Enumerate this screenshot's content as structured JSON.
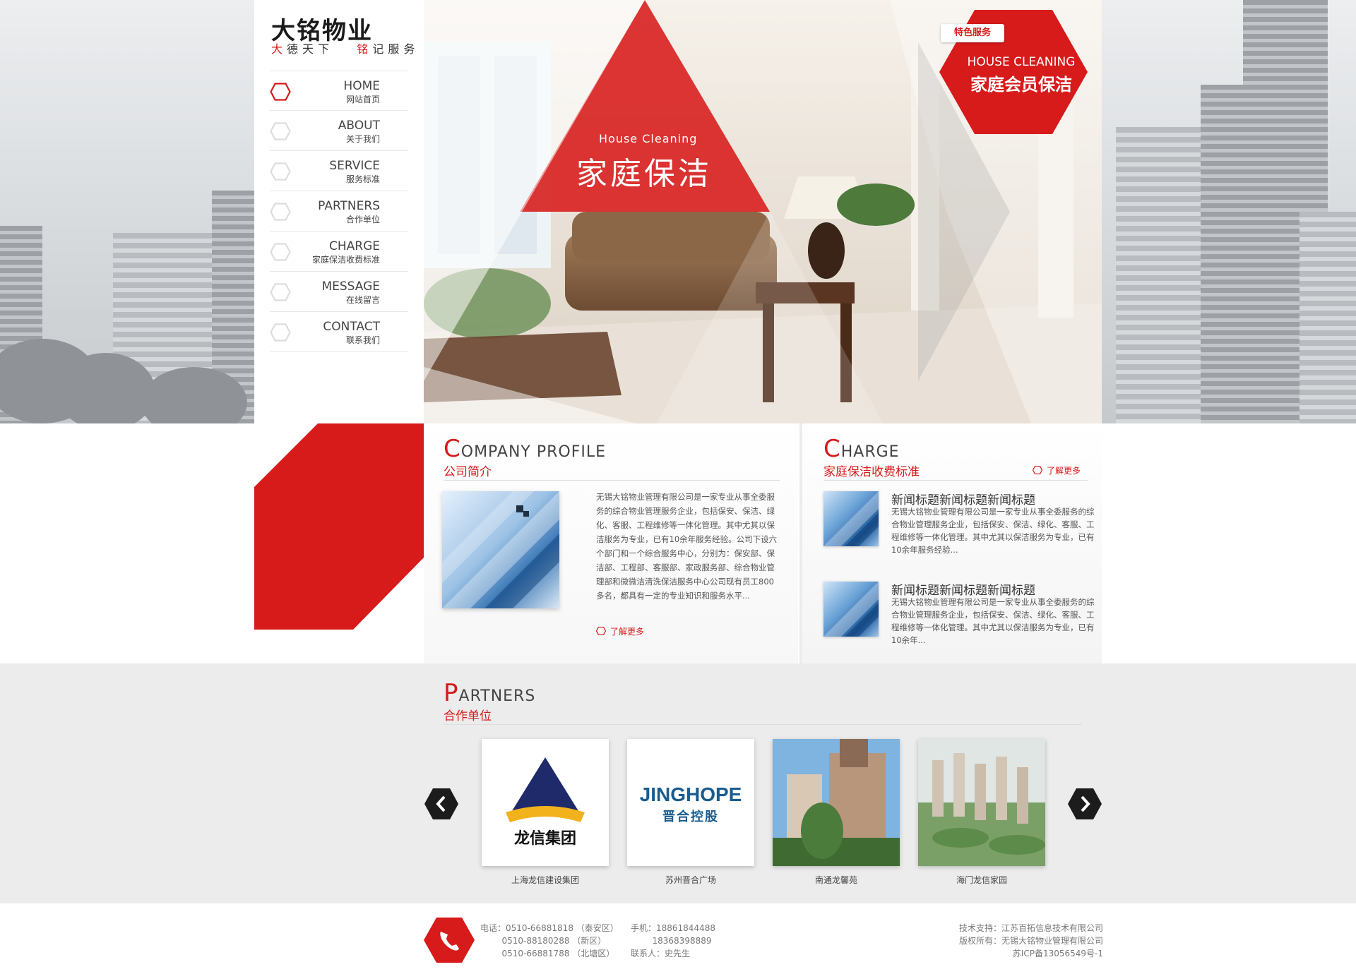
{
  "brand": {
    "name_cn": "大铭物业",
    "slogan_part1": "大",
    "slogan_part2": "德天下",
    "slogan_part3": "铭",
    "slogan_part4": "记服务",
    "accent_color": "#d71a1a"
  },
  "nav": [
    {
      "en": "HOME",
      "cn": "网站首页",
      "active": true
    },
    {
      "en": "ABOUT",
      "cn": "关于我们",
      "active": false
    },
    {
      "en": "SERVICE",
      "cn": "服务标准",
      "active": false
    },
    {
      "en": "PARTNERS",
      "cn": "合作单位",
      "active": false
    },
    {
      "en": "CHARGE",
      "cn": "家庭保洁收费标准",
      "active": false
    },
    {
      "en": "MESSAGE",
      "cn": "在线留言",
      "active": false
    },
    {
      "en": "CONTACT",
      "cn": "联系我们",
      "active": false
    }
  ],
  "hero": {
    "en": "House Cleaning",
    "cn": "家庭保洁",
    "badge_tag": "特色服务",
    "badge_en": "HOUSE CLEANING",
    "badge_cn": "家庭会员保洁"
  },
  "profile": {
    "title_first": "C",
    "title_rest": "OMPANY PROFILE",
    "title_cn": "公司简介",
    "text": "无锡大铭物业管理有限公司是一家专业从事全委服务的综合物业管理服务企业，包括保安、保洁、绿化、客服、工程维修等一体化管理。其中尤其以保洁服务为专业，已有10余年服务经验。公司下设六个部门和一个综合服务中心，分别为：保安部、保洁部、工程部、客服部、家政服务部、综合物业管理部和微微洁清洗保洁服务中心公司现有员工800多名，都具有一定的专业知识和服务水平...",
    "more": "了解更多"
  },
  "charge": {
    "title_first": "C",
    "title_rest": "HARGE",
    "title_cn": "家庭保洁收费标准",
    "more": "了解更多",
    "news": [
      {
        "title": "新闻标题新闻标题新闻标题",
        "body": "无锡大铭物业管理有限公司是一家专业从事全委服务的综合物业管理服务企业，包括保安、保洁、绿化、客服、工程维修等一体化管理。其中尤其以保洁服务为专业，已有10余年服务经验..."
      },
      {
        "title": "新闻标题新闻标题新闻标题",
        "body": "无锡大铭物业管理有限公司是一家专业从事全委服务的综合物业管理服务企业，包括保安、保洁、绿化、客服、工程维修等一体化管理。其中尤其以保洁服务为专业，已有10余年..."
      }
    ]
  },
  "partners": {
    "title_first": "P",
    "title_rest": "ARTNERS",
    "title_cn": "合作单位",
    "items": [
      {
        "name": "上海龙信建设集团",
        "logo_text": "龙信集团"
      },
      {
        "name": "苏州晋合广场",
        "logo_en": "JINGHOPE",
        "logo_cn": "晋合控股"
      },
      {
        "name": "南通龙馨苑"
      },
      {
        "name": "海门龙信家园"
      }
    ]
  },
  "footer": {
    "phone_lines": "电话：0510-66881818 （泰安区）\n        0510-88180288 （新区）\n        0510-66881788 （北塘区）",
    "mobile_lines": "手机：18861844488\n        18368398889\n联系人：史先生",
    "right_lines": "技术支持：江苏百拓信息技术有限公司\n版权所有：无锡大铭物业管理有限公司\n苏ICP备13056549号-1"
  }
}
